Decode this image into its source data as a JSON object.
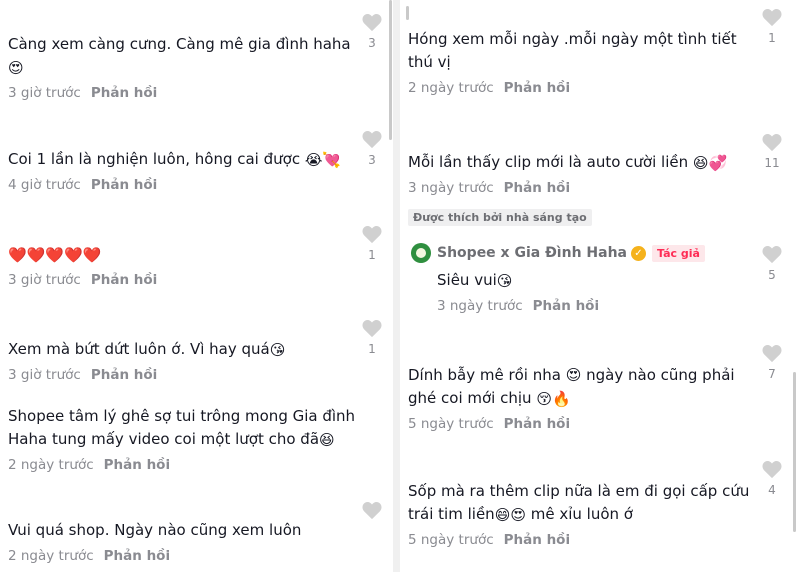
{
  "left_comments": [
    {
      "text": "Càng xem càng cưng. Càng mê gia đình haha",
      "emojis": "😍",
      "time": "3 giờ trước",
      "reply": "Phản hồi",
      "likes": "3"
    },
    {
      "text": "Coi 1 lần là nghiện luôn, hông cai được",
      "emojis": "😭💘",
      "time": "4 giờ trước",
      "reply": "Phản hồi",
      "likes": "3"
    },
    {
      "text": "",
      "emojis": "❤️❤️❤️❤️❤️",
      "time": "3 giờ trước",
      "reply": "Phản hồi",
      "likes": "1"
    },
    {
      "text": "Xem mà bứt dứt luôn ớ. Vì hay quá",
      "emojis": "😘",
      "time": "3 giờ trước",
      "reply": "Phản hồi",
      "likes": "1"
    },
    {
      "text": "Shopee tâm lý ghê sợ tui trông mong Gia đình Haha tung mấy video coi một lượt cho đã",
      "emojis": "😆",
      "time": "2 ngày trước",
      "reply": "Phản hồi",
      "likes": ""
    },
    {
      "text": "Vui quá shop. Ngày nào cũng xem luôn",
      "emojis": "",
      "time": "2 ngày trước",
      "reply": "Phản hồi",
      "likes": ""
    }
  ],
  "right_comments": [
    {
      "text": "Hóng xem mỗi ngày .mỗi ngày một tình tiết thú vị",
      "emojis": "",
      "time": "2 ngày trước",
      "reply": "Phản hồi",
      "likes": "1"
    },
    {
      "text": "Mỗi lần thấy clip mới là auto cười liền",
      "emojis": "😆💞",
      "time": "3 ngày trước",
      "reply": "Phản hồi",
      "likes": "11"
    },
    {
      "text": "Dính bẫy mê rồi nha 😍 ngày nào cũng phải ghé coi mới chịu",
      "emojis": "😚🔥",
      "time": "5 ngày trước",
      "reply": "Phản hồi",
      "likes": "7"
    },
    {
      "text": "Sốp mà ra thêm clip nữa là em đi gọi cấp cứu trái tim liền",
      "emojis": "😄😍",
      "text2": "mê xỉu luôn ớ",
      "time": "5 ngày trước",
      "reply": "Phản hồi",
      "likes": "4"
    }
  ],
  "creator_reply": {
    "tag": "Được thích bởi nhà sáng tạo",
    "author": "Shopee x Gia Đình Haha",
    "author_badge": "Tác giả",
    "text": "Siêu vui",
    "emojis": "😘",
    "time": "3 ngày trước",
    "reply": "Phản hồi",
    "likes": "5"
  },
  "colors": {
    "heart": "#d0d0d0",
    "muted": "#8a8b91",
    "author_badge": "#fe2c55"
  },
  "icons": {
    "like": "heart-icon",
    "verified": "verified-badge-icon",
    "avatar": "shopee-avatar"
  }
}
